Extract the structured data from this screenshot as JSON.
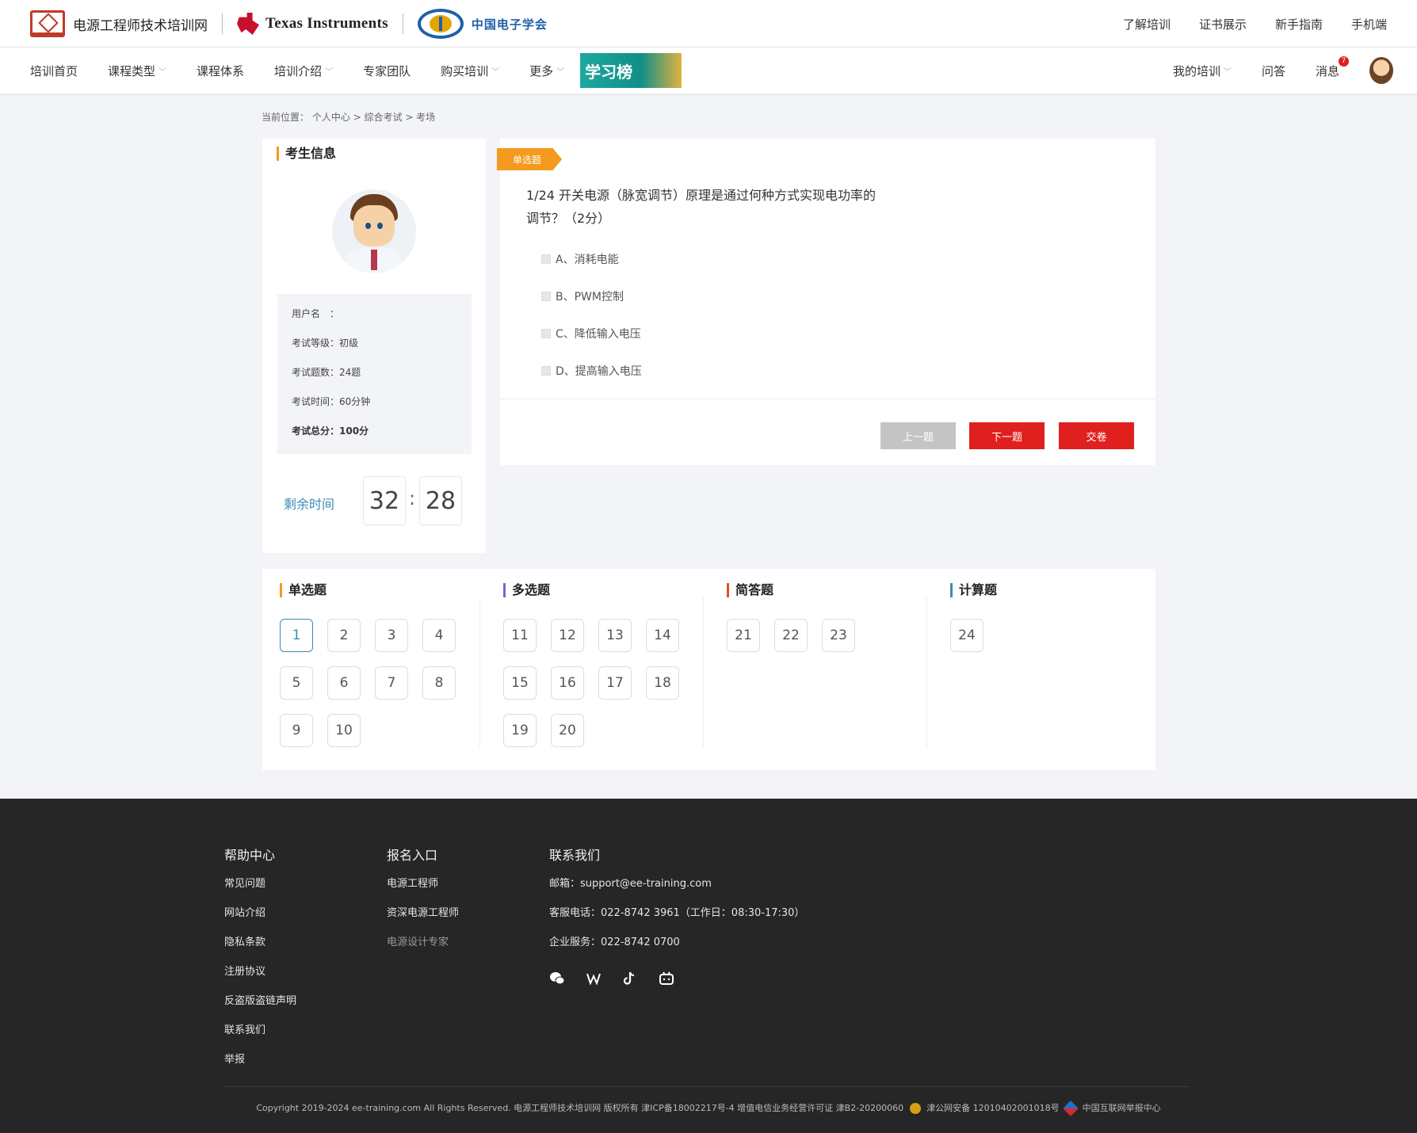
{
  "header": {
    "site_name": "电源工程师技术培训网",
    "partner_ti": "Texas Instruments",
    "partner_cie": "中国电子学会",
    "links": [
      "了解培训",
      "证书展示",
      "新手指南",
      "手机端"
    ]
  },
  "nav": {
    "items": [
      "培训首页",
      "课程类型",
      "课程体系",
      "培训介绍",
      "专家团队",
      "购买培训",
      "更多"
    ],
    "banner": "学习榜",
    "my_training": "我的培训",
    "qa": "问答",
    "messages": "消息",
    "message_count": "7"
  },
  "breadcrumb": "当前位置： 个人中心 > 综合考试 > 考场",
  "student": {
    "title": "考生信息",
    "username": "用户名　：",
    "level": "考试等级：初级",
    "count": "考试题数：24题",
    "time": "考试时间：60分钟",
    "score": "考试总分：100分",
    "timer_label": "剩余时间",
    "minutes": "32",
    "seconds": "28"
  },
  "question": {
    "tag": "单选题",
    "text": "1/24   开关电源（脉宽调节）原理是通过何种方式实现电功率的调节？（2分）",
    "options": [
      "A、消耗电能",
      "B、PWM控制",
      "C、降低输入电压",
      "D、提高输入电压"
    ],
    "prev": "上一题",
    "next": "下一题",
    "submit": "交卷"
  },
  "sheet": {
    "sections": [
      {
        "title": "单选题",
        "color": "#f39a1f",
        "numbers": [
          "1",
          "2",
          "3",
          "4",
          "5",
          "6",
          "7",
          "8",
          "9",
          "10"
        ]
      },
      {
        "title": "多选题",
        "color": "#6b6bd6",
        "numbers": [
          "11",
          "12",
          "13",
          "14",
          "15",
          "16",
          "17",
          "18",
          "19",
          "20"
        ]
      },
      {
        "title": "简答题",
        "color": "#e0501f",
        "numbers": [
          "21",
          "22",
          "23"
        ]
      },
      {
        "title": "计算题",
        "color": "#3a8db5",
        "numbers": [
          "24"
        ]
      }
    ],
    "active": "1"
  },
  "footer": {
    "help": {
      "title": "帮助中心",
      "items": [
        "常见问题",
        "网站介绍",
        "隐私条款",
        "注册协议",
        "反盗版盗链声明",
        "联系我们",
        "举报"
      ]
    },
    "signup": {
      "title": "报名入口",
      "items": [
        "电源工程师",
        "资深电源工程师",
        "电源设计专家"
      ]
    },
    "contact": {
      "title": "联系我们",
      "email": "邮箱：support@ee-training.com",
      "phone": "客服电话：022-8742 3961（工作日：08:30-17:30）",
      "biz": "企业服务：022-8742 0700"
    },
    "copyright": "Copyright 2019-2024 ee-training.com All Rights Reserved. 电源工程师技术培训网 版权所有 津ICP备18002217号-4  增值电信业务经营许可证 津B2-20200060",
    "police": "津公网安备 12010402001018号",
    "report": "中国互联网举报中心"
  }
}
